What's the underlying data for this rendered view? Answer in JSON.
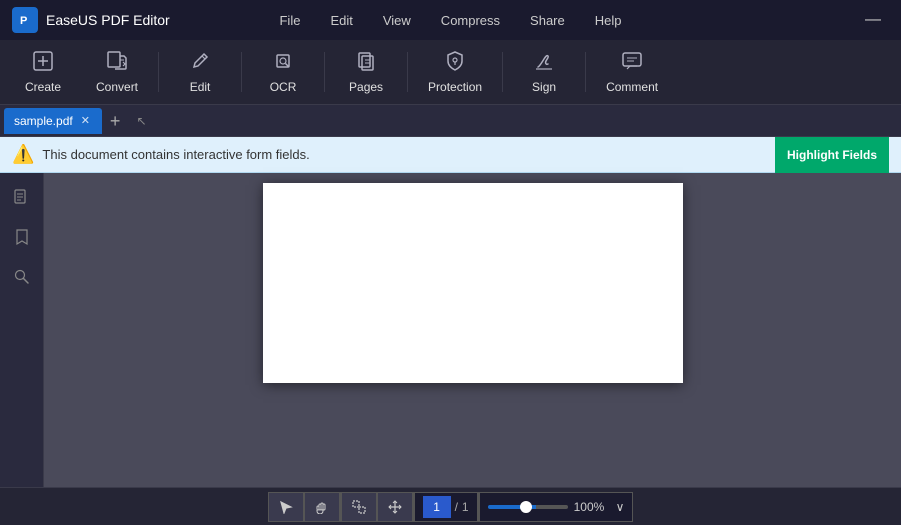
{
  "titleBar": {
    "appName": "EaseUS PDF Editor",
    "logoText": "P",
    "nav": {
      "file": "File",
      "edit": "Edit",
      "view": "View",
      "compress": "Compress",
      "share": "Share",
      "help": "Help"
    },
    "minimizeBtn": "—"
  },
  "toolbar": {
    "buttons": [
      {
        "id": "create",
        "label": "Create",
        "icon": "➕"
      },
      {
        "id": "convert",
        "label": "Convert",
        "icon": "🔄"
      },
      {
        "id": "edit",
        "label": "Edit",
        "icon": "✏️"
      },
      {
        "id": "ocr",
        "label": "OCR",
        "icon": "🔍"
      },
      {
        "id": "pages",
        "label": "Pages",
        "icon": "📄"
      },
      {
        "id": "protection",
        "label": "Protection",
        "icon": "🛡️"
      },
      {
        "id": "sign",
        "label": "Sign",
        "icon": "🖊️"
      },
      {
        "id": "comment",
        "label": "Comment",
        "icon": "💬"
      }
    ]
  },
  "tabs": {
    "activeTab": "sample.pdf",
    "addTabTooltip": "New tab"
  },
  "infoBar": {
    "message": "This document contains interactive form fields.",
    "highlightBtn": "Highlight Fields",
    "iconSymbol": "⚠️"
  },
  "sidebar": {
    "icons": [
      "☰",
      "🏷️",
      "🔍"
    ]
  },
  "statusBar": {
    "pageInput": "1",
    "pageSeparator": "/",
    "pageTotal": "1",
    "zoomLevel": "100%",
    "dropdownArrow": "∨"
  }
}
